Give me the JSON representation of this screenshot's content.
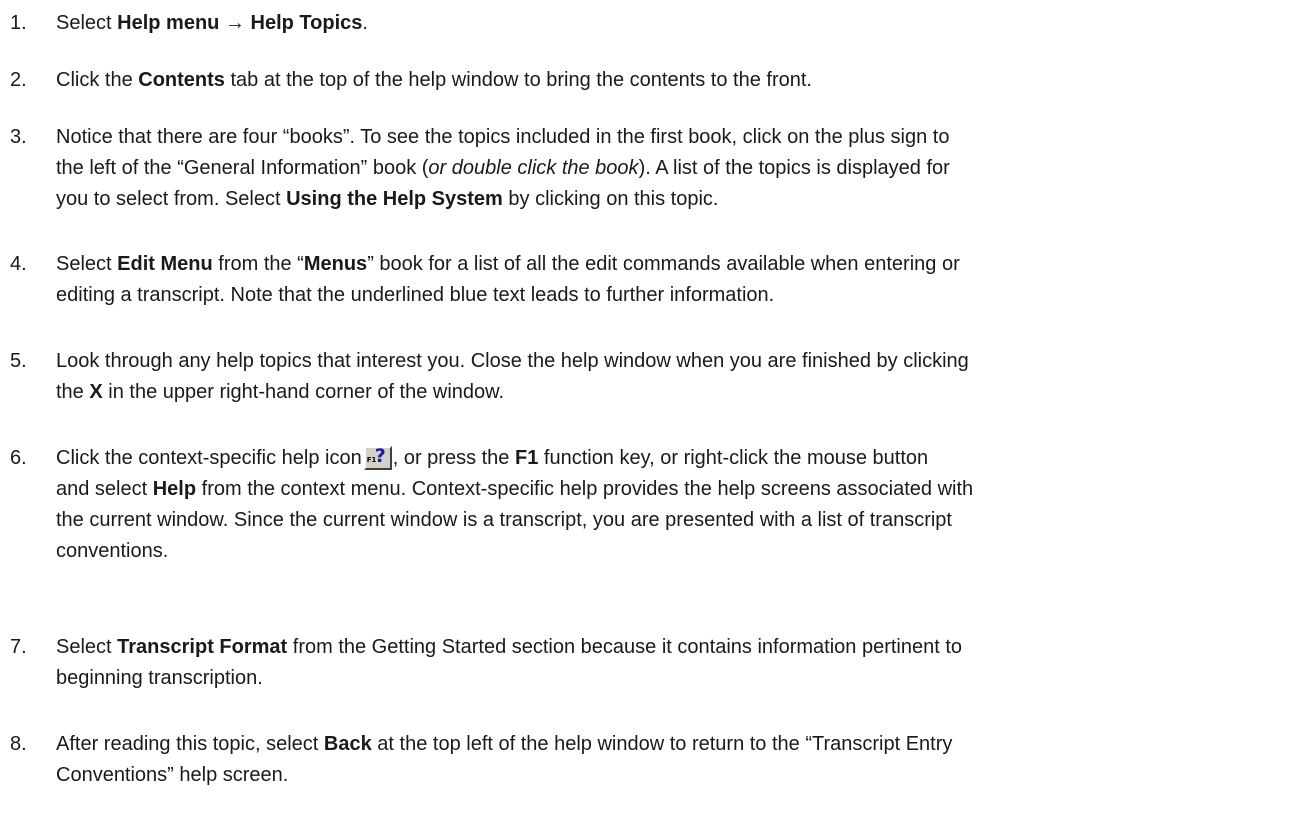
{
  "steps": [
    {
      "num": "1.",
      "lines": [
        [
          {
            "t": "Select "
          },
          {
            "t": "Help menu → Help Topics",
            "b": true
          },
          {
            "t": "."
          }
        ]
      ]
    },
    {
      "num": "2.",
      "lines": [
        [
          {
            "t": "Click the "
          },
          {
            "t": "Contents",
            "b": true
          },
          {
            "t": " tab at the top of the help window to bring the contents to the front."
          }
        ]
      ]
    },
    {
      "num": "3.",
      "lines": [
        [
          {
            "t": "Notice that there are four “books”. To see the topics included in the first book, click on the plus sign to"
          }
        ],
        [
          {
            "t": "the left of the “General Information” book ("
          },
          {
            "t": "or double click the book",
            "i": true
          },
          {
            "t": "). A list of the topics is displayed for"
          }
        ],
        [
          {
            "t": "you to select from. Select "
          },
          {
            "t": "Using the Help System",
            "b": true
          },
          {
            "t": " by clicking on this topic."
          }
        ]
      ]
    },
    {
      "num": "4.",
      "lines": [
        [
          {
            "t": "Select "
          },
          {
            "t": "Edit Menu",
            "b": true
          },
          {
            "t": " from the “"
          },
          {
            "t": "Menus",
            "b": true
          },
          {
            "t": "” book for a list of all the edit commands available when entering or"
          }
        ],
        [
          {
            "t": "editing a transcript. Note that the underlined blue text leads to further information."
          }
        ]
      ]
    },
    {
      "num": "5.",
      "lines": [
        [
          {
            "t": "Look through any help topics that interest you. Close the help window when you are finished by clicking"
          }
        ],
        [
          {
            "t": "the "
          },
          {
            "t": "X",
            "b": true
          },
          {
            "t": " in the upper right-hand corner of the window."
          }
        ]
      ]
    },
    {
      "num": "6.",
      "lines": [
        [
          {
            "t": "Click the context-specific help icon"
          },
          {
            "icon": "f1-help-icon",
            "label": "F1",
            "glyph": "?"
          },
          {
            "t": ", or press the "
          },
          {
            "t": "F1",
            "b": true
          },
          {
            "t": " function key, or right-click the mouse button"
          }
        ],
        [
          {
            "t": "and select "
          },
          {
            "t": "Help",
            "b": true
          },
          {
            "t": " from the context menu. Context-specific help provides the help screens associated with"
          }
        ],
        [
          {
            "t": "the current window. Since the current window is a transcript, you are presented with a list of transcript"
          }
        ],
        [
          {
            "t": "conventions."
          }
        ]
      ]
    },
    {
      "num": "7.",
      "lines": [
        [
          {
            "t": "Select "
          },
          {
            "t": "Transcript Format",
            "b": true
          },
          {
            "t": " from the Getting Started section because it contains information pertinent to"
          }
        ],
        [
          {
            "t": "beginning transcription."
          }
        ]
      ]
    },
    {
      "num": "8.",
      "lines": [
        [
          {
            "t": "After reading this topic, select "
          },
          {
            "t": "Back",
            "b": true
          },
          {
            "t": " at the top left of the help window to return to the “Transcript Entry"
          }
        ],
        [
          {
            "t": "Conventions” help screen."
          }
        ]
      ]
    }
  ]
}
